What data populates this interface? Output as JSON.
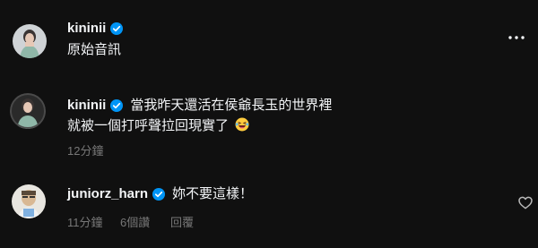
{
  "post": {
    "author": "kininii",
    "text": "原始音訊"
  },
  "reply_1": {
    "author": "kininii",
    "line1": "當我昨天還活在侯爺長玉的世界裡",
    "line2": "就被一個打呼聲拉回現實了",
    "time": "12分鐘"
  },
  "reply_2": {
    "author": "juniorz_harn",
    "text": "妳不要這樣！",
    "time": "11分鐘",
    "likes": "6個讚",
    "reply_label": "回覆"
  },
  "icons": {
    "verified": "verified-badge-icon",
    "more": "more-options-icon",
    "heart": "heart-icon",
    "emoji": "grinning-squinting-face-emoji"
  },
  "colors": {
    "background": "#101010",
    "text": "#f3f5f7",
    "muted": "#777777",
    "verified": "#0095f6"
  }
}
